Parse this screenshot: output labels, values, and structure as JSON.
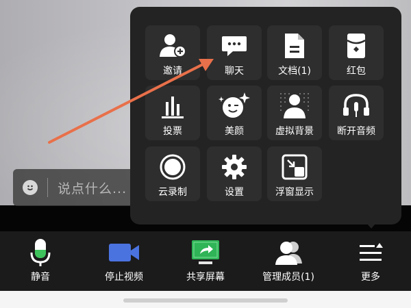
{
  "chat_input": {
    "placeholder": "说点什么..."
  },
  "more_menu": {
    "items": [
      {
        "label": "邀请",
        "icon": "invite-user-icon"
      },
      {
        "label": "聊天",
        "icon": "chat-icon"
      },
      {
        "label": "文档(1)",
        "icon": "document-icon"
      },
      {
        "label": "红包",
        "icon": "red-packet-icon"
      },
      {
        "label": "投票",
        "icon": "vote-icon"
      },
      {
        "label": "美颜",
        "icon": "beauty-icon"
      },
      {
        "label": "虚拟背景",
        "icon": "virtual-background-icon"
      },
      {
        "label": "断开音频",
        "icon": "disconnect-audio-icon"
      },
      {
        "label": "云录制",
        "icon": "cloud-record-icon"
      },
      {
        "label": "设置",
        "icon": "settings-gear-icon"
      },
      {
        "label": "浮窗显示",
        "icon": "floating-window-icon"
      }
    ]
  },
  "toolbar": {
    "items": [
      {
        "label": "静音",
        "icon": "microphone-icon"
      },
      {
        "label": "停止视频",
        "icon": "video-camera-icon"
      },
      {
        "label": "共享屏幕",
        "icon": "share-screen-icon"
      },
      {
        "label": "管理成员(1)",
        "icon": "participants-icon"
      },
      {
        "label": "更多",
        "icon": "more-menu-icon"
      }
    ]
  },
  "colors": {
    "panel_bg": "#232323",
    "tile_bg": "#2e2e2e",
    "toolbar_bg": "#1b1b1b",
    "arrow": "#e8704a",
    "mic_green": "#3ec25b",
    "video_blue": "#4b73e0",
    "share_green": "#2fb457"
  }
}
